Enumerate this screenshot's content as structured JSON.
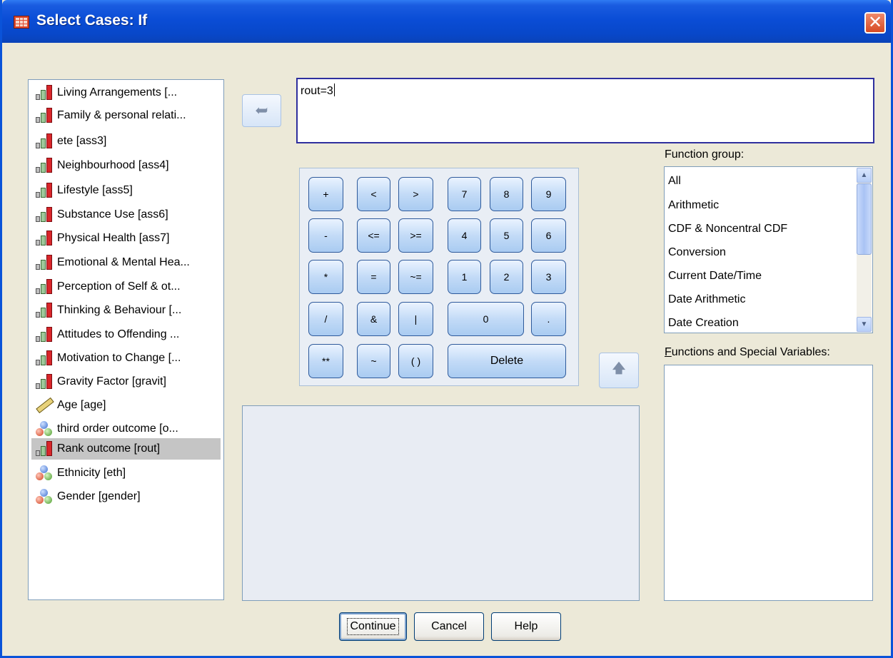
{
  "window": {
    "title": "Select Cases: If",
    "close_glyph": "✕"
  },
  "variables": [
    {
      "label": "Living Arrangements [...",
      "icon": "ordinal-icon"
    },
    {
      "label": "Family & personal relati...",
      "icon": "ordinal-icon"
    },
    {
      "label": "ete [ass3]",
      "icon": "ordinal-icon"
    },
    {
      "label": "Neighbourhood [ass4]",
      "icon": "ordinal-icon"
    },
    {
      "label": "Lifestyle [ass5]",
      "icon": "ordinal-icon"
    },
    {
      "label": "Substance Use [ass6]",
      "icon": "ordinal-icon"
    },
    {
      "label": "Physical Health [ass7]",
      "icon": "ordinal-icon"
    },
    {
      "label": "Emotional & Mental Hea...",
      "icon": "ordinal-icon"
    },
    {
      "label": "Perception of Self & ot...",
      "icon": "ordinal-icon"
    },
    {
      "label": "Thinking & Behaviour [...",
      "icon": "ordinal-icon"
    },
    {
      "label": "Attitudes to Offending ...",
      "icon": "ordinal-icon"
    },
    {
      "label": "Motivation to Change [...",
      "icon": "ordinal-icon"
    },
    {
      "label": "Gravity Factor [gravit]",
      "icon": "ordinal-icon"
    },
    {
      "label": "Age [age]",
      "icon": "scale-icon"
    },
    {
      "label": "third order outcome [o...",
      "icon": "nominal-icon"
    },
    {
      "label": "Rank outcome [rout]",
      "icon": "ordinal-icon",
      "selected": true
    },
    {
      "label": "Ethnicity [eth]",
      "icon": "nominal-icon"
    },
    {
      "label": "Gender [gender]",
      "icon": "nominal-icon"
    }
  ],
  "expression": {
    "value": "rout=3"
  },
  "insert_arrow": "➥",
  "keypad": {
    "plus": "+",
    "lt": "<",
    "gt": ">",
    "k7": "7",
    "k8": "8",
    "k9": "9",
    "minus": "-",
    "le": "<=",
    "ge": ">=",
    "k4": "4",
    "k5": "5",
    "k6": "6",
    "mult": "*",
    "eq": "=",
    "ne": "~=",
    "k1": "1",
    "k2": "2",
    "k3": "3",
    "div": "/",
    "and": "&",
    "or": "|",
    "k0": "0",
    "dot": ".",
    "pow": "**",
    "not": "~",
    "paren": "( )",
    "delete": "Delete"
  },
  "up_arrow": "🡅",
  "function_group": {
    "label_pre": "Function ",
    "label_underline": "g",
    "label_post": "roup:",
    "items": [
      "All",
      "Arithmetic",
      "CDF & Noncentral CDF",
      "Conversion",
      "Current Date/Time",
      "Date Arithmetic",
      "Date Creation"
    ]
  },
  "functions_special": {
    "label_underline": "F",
    "label_post": "unctions and Special Variables:"
  },
  "buttons": {
    "continue": "Continue",
    "cancel": "Cancel",
    "help": "Help"
  },
  "colors": {
    "titlebar": "#0A4DD6",
    "dialog_bg": "#ECE9D8",
    "selection": "#C5C5C5"
  }
}
